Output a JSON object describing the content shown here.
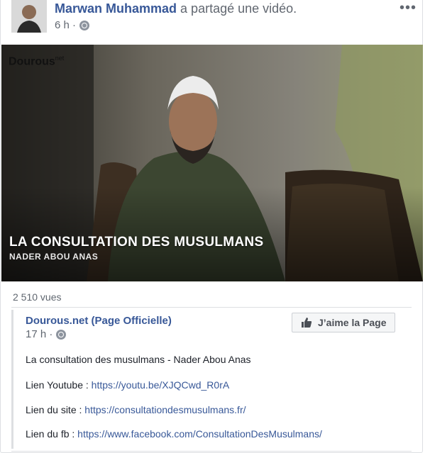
{
  "post": {
    "author": "Marwan Muhammad",
    "action": "a partagé une vidéo.",
    "time": "6 h ·",
    "menu_icon": "more-dots-icon"
  },
  "video": {
    "logo_text": "Dourous",
    "logo_sup": "net",
    "title": "LA CONSULTATION DES MUSULMANS",
    "subtitle": "NADER ABOU ANAS",
    "views": "2 510 vues"
  },
  "shared": {
    "page_name": "Dourous.net (Page Officielle)",
    "time": "17 h ·",
    "like_button": "J’aime la Page",
    "lines": [
      {
        "label": "La consultation des musulmans - Nader Abou Anas",
        "link": ""
      },
      {
        "label": "Lien Youtube : ",
        "link": "https://youtu.be/XJQCwd_R0rA"
      },
      {
        "label": "Lien du site : ",
        "link": "https://consultationdesmusulmans.fr/"
      },
      {
        "label": "Lien du fb : ",
        "link": "https://www.facebook.com/ConsultationDesMusulmans/"
      }
    ]
  },
  "colors": {
    "link": "#385898",
    "meta": "#616770"
  }
}
